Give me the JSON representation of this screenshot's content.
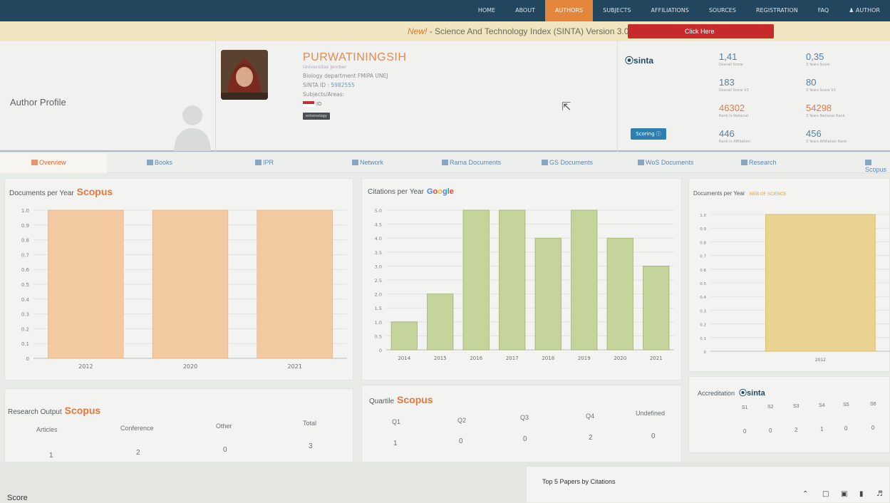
{
  "nav": {
    "items": [
      {
        "label": "HOME",
        "active": false
      },
      {
        "label": "ABOUT",
        "active": false
      },
      {
        "label": "AUTHORS",
        "active": true
      },
      {
        "label": "SUBJECTS",
        "active": false
      },
      {
        "label": "AFFILIATIONS",
        "active": false
      },
      {
        "label": "SOURCES",
        "active": false
      },
      {
        "label": "REGISTRATION",
        "active": false
      },
      {
        "label": "FAQ",
        "active": false
      },
      {
        "label": "AUTHOR",
        "active": false
      }
    ]
  },
  "announcement": {
    "new_label": "New!",
    "text": " - Science And Technology Index (SINTA) Version 3.0",
    "button": "Click Here"
  },
  "profile": {
    "section_label": "Author Profile",
    "name": "PURWATININGSIH",
    "university": "Universitas Jember",
    "department": "Biology department FMIPA UNEJ",
    "sinta_id_label": "SINTA ID : ",
    "sinta_id": "5982555",
    "subjects_label": "Subjects/Areas:",
    "country": "ID",
    "tag": "entomology"
  },
  "sinta": {
    "logo": "sinta",
    "scoring_button": "Scoring",
    "stats": [
      {
        "value": "1,41",
        "label": "Overall Score",
        "color": "blue"
      },
      {
        "value": "0,35",
        "label": "3 Years Score",
        "color": "blue"
      },
      {
        "value": "183",
        "label": "Overall Score V3",
        "color": "blue"
      },
      {
        "value": "80",
        "label": "3 Years Score V3",
        "color": "blue"
      },
      {
        "value": "46302",
        "label": "Rank in National",
        "color": "orange"
      },
      {
        "value": "54298",
        "label": "3 Years National Rank",
        "color": "orange"
      },
      {
        "value": "446",
        "label": "Rank in Affiliation",
        "color": "blue"
      },
      {
        "value": "456",
        "label": "3 Years Affiliation Rank",
        "color": "blue"
      }
    ]
  },
  "tabs": [
    {
      "label": "Overview",
      "active": true
    },
    {
      "label": "Books",
      "active": false
    },
    {
      "label": "IPR",
      "active": false
    },
    {
      "label": "Network",
      "active": false
    },
    {
      "label": "Rama Documents",
      "active": false
    },
    {
      "label": "GS Documents",
      "active": false
    },
    {
      "label": "WoS Documents",
      "active": false
    },
    {
      "label": "Research",
      "active": false
    },
    {
      "label": "Scopus",
      "active": false
    }
  ],
  "panels": {
    "scopus_docs_title": "Documents per Year",
    "scopus_brand": "Scopus",
    "citations_title": "Citations per Year",
    "wos_docs_title": "Documents per Year",
    "wos_brand": "WEB OF SCIENCE",
    "research_title": "Research Output",
    "quartile_title": "Quartile",
    "accreditation_title": "Accreditation",
    "score_label": "Score",
    "top5_title": "Top 5 Papers by Citations"
  },
  "research_output": {
    "headers": [
      "Articles",
      "Conference",
      "Other",
      "Total"
    ],
    "values": [
      "1",
      "2",
      "0",
      "3"
    ]
  },
  "quartile": {
    "headers": [
      "Q1",
      "Q2",
      "Q3",
      "Q4",
      "Undefined"
    ],
    "values": [
      "1",
      "0",
      "0",
      "2",
      "0"
    ]
  },
  "accreditation": {
    "headers": [
      "S1",
      "S2",
      "S3",
      "S4",
      "S5",
      "S6"
    ],
    "values": [
      "0",
      "0",
      "2",
      "1",
      "0",
      "0"
    ]
  },
  "colors": {
    "scopus_bar": "#f2c9a0",
    "google_bar": "#c5d49a",
    "wos_bar": "#ead390",
    "accent": "#e8763d"
  },
  "chart_data": [
    {
      "type": "bar",
      "title": "Documents per Year",
      "categories": [
        "2012",
        "2020",
        "2021"
      ],
      "values": [
        1,
        1,
        1
      ],
      "ylim": [
        0,
        1
      ],
      "yticks": [
        "0",
        "0.1",
        "0.2",
        "0.3",
        "0.4",
        "0.5",
        "0.6",
        "0.7",
        "0.8",
        "0.9",
        "1.0"
      ],
      "grid": true
    },
    {
      "type": "bar",
      "title": "Citations per Year",
      "categories": [
        "2014",
        "2015",
        "2016",
        "2017",
        "2018",
        "2019",
        "2020",
        "2021"
      ],
      "values": [
        1,
        2,
        5,
        5,
        4,
        5,
        4,
        3
      ],
      "ylim": [
        0,
        5
      ],
      "yticks": [
        "0",
        "0.5",
        "1.0",
        "1.5",
        "2.0",
        "2.5",
        "3.0",
        "3.5",
        "4.0",
        "4.5",
        "5.0"
      ],
      "grid": true
    },
    {
      "type": "bar",
      "title": "Documents per Year",
      "categories": [
        "2012"
      ],
      "values": [
        1
      ],
      "ylim": [
        0,
        1
      ],
      "yticks": [
        "0",
        "0.1",
        "0.2",
        "0.3",
        "0.4",
        "0.5",
        "0.6",
        "0.7",
        "0.8",
        "0.9",
        "1.0"
      ],
      "grid": true
    }
  ]
}
